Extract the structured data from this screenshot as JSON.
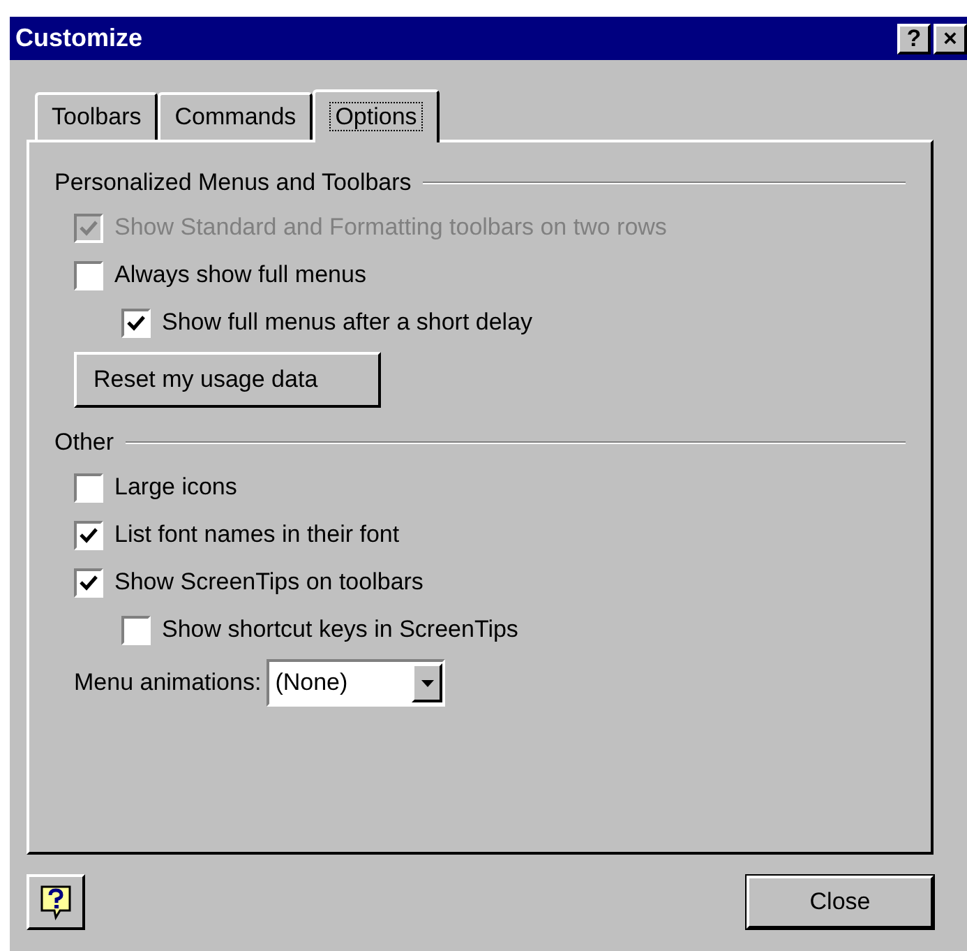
{
  "window": {
    "title": "Customize",
    "title_buttons": [
      "?",
      "×"
    ]
  },
  "tabs": [
    {
      "label": "Toolbars",
      "selected": false
    },
    {
      "label": "Commands",
      "selected": false
    },
    {
      "label": "Options",
      "selected": true
    }
  ],
  "sections": [
    {
      "title": "Personalized Menus and Toolbars",
      "items": [
        {
          "kind": "checkbox",
          "label": "Show Standard and Formatting toolbars on two rows",
          "checked": true,
          "disabled": true
        },
        {
          "kind": "checkbox",
          "label": "Always show full menus",
          "checked": false,
          "disabled": false,
          "children": [
            {
              "kind": "checkbox",
              "label": "Show full menus after a short delay",
              "checked": true,
              "disabled": false
            }
          ]
        },
        {
          "kind": "button",
          "label": "Reset my usage data"
        }
      ]
    },
    {
      "title": "Other",
      "items": [
        {
          "kind": "checkbox",
          "label": "Large icons",
          "checked": false,
          "disabled": false
        },
        {
          "kind": "checkbox",
          "label": "List font names in their font",
          "checked": true,
          "disabled": false
        },
        {
          "kind": "checkbox",
          "label": "Show ScreenTips on toolbars",
          "checked": true,
          "disabled": false,
          "children": [
            {
              "kind": "checkbox",
              "label": "Show shortcut keys in ScreenTips",
              "checked": false,
              "disabled": false
            }
          ]
        },
        {
          "kind": "dropdown",
          "label": "Menu animations:",
          "value": "(None)"
        }
      ]
    }
  ],
  "footer": {
    "close_button": "Close"
  }
}
